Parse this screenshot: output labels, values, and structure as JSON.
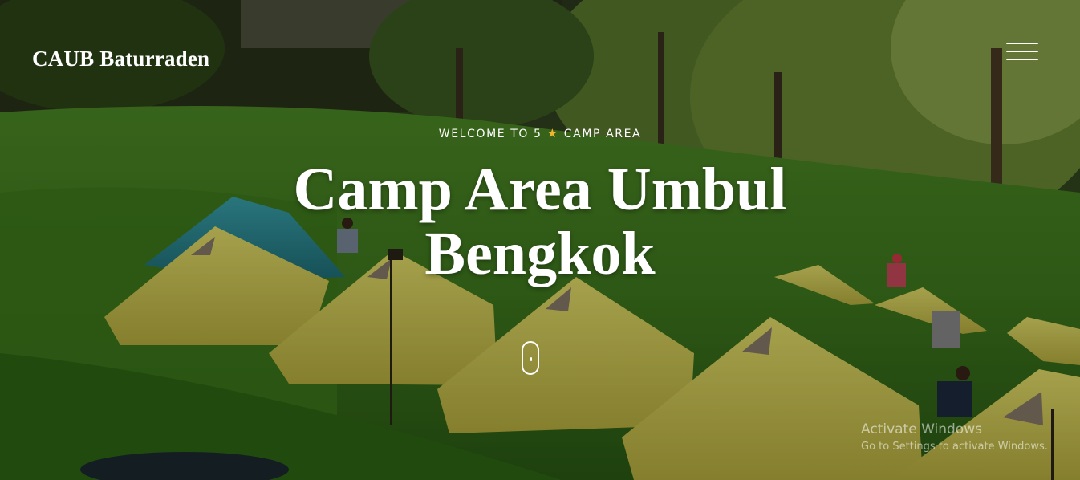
{
  "header": {
    "brand": "CAUB Baturraden",
    "menu_icon": "hamburger-menu-icon"
  },
  "hero": {
    "welcome_prefix": "WELCOME TO 5",
    "welcome_star": "★",
    "welcome_suffix": "CAMP AREA",
    "title_line1": "Camp Area Umbul",
    "title_line2": "Bengkok",
    "scroll_icon": "mouse-scroll-icon",
    "background": "campsite-photo-yellow-tents-on-grass"
  },
  "os_watermark": {
    "title": "Activate Windows",
    "subtitle": "Go to Settings to activate Windows."
  },
  "colors": {
    "text": "#ffffff",
    "star": "#f3b52d",
    "tent_yellow": "#d9d25a",
    "tent_teal": "#2f8f99",
    "grass": "#4f8a2a"
  }
}
